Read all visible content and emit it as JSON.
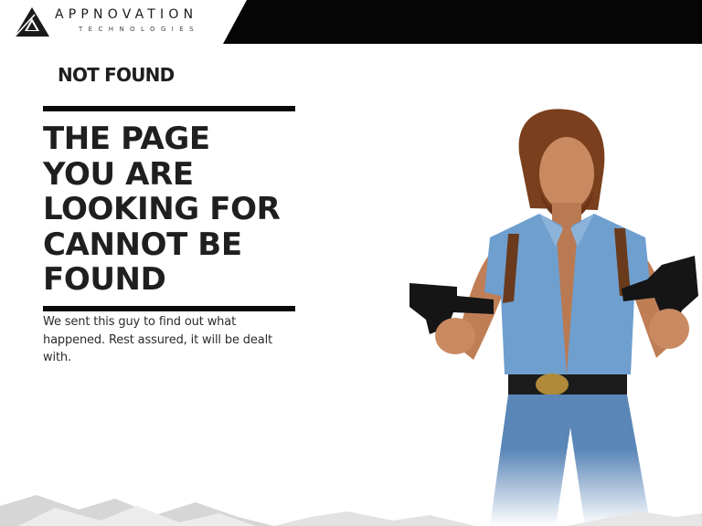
{
  "brand": {
    "name": "APPNOVATION",
    "tagline": "TECHNOLOGIES",
    "icon": "triangle-logo-icon"
  },
  "error": {
    "status_label": "NOT FOUND",
    "headline_lines": [
      "THE PAGE",
      "YOU ARE",
      "LOOKING FOR",
      "CANNOT BE",
      "FOUND"
    ],
    "message": "We sent this guy to find out what happened. Rest assured, it will be dealt with."
  },
  "colors": {
    "header_bg": "#050505",
    "text": "#1f1f1f",
    "rule": "#0a0a0a",
    "denim": "#6f9fcf"
  }
}
